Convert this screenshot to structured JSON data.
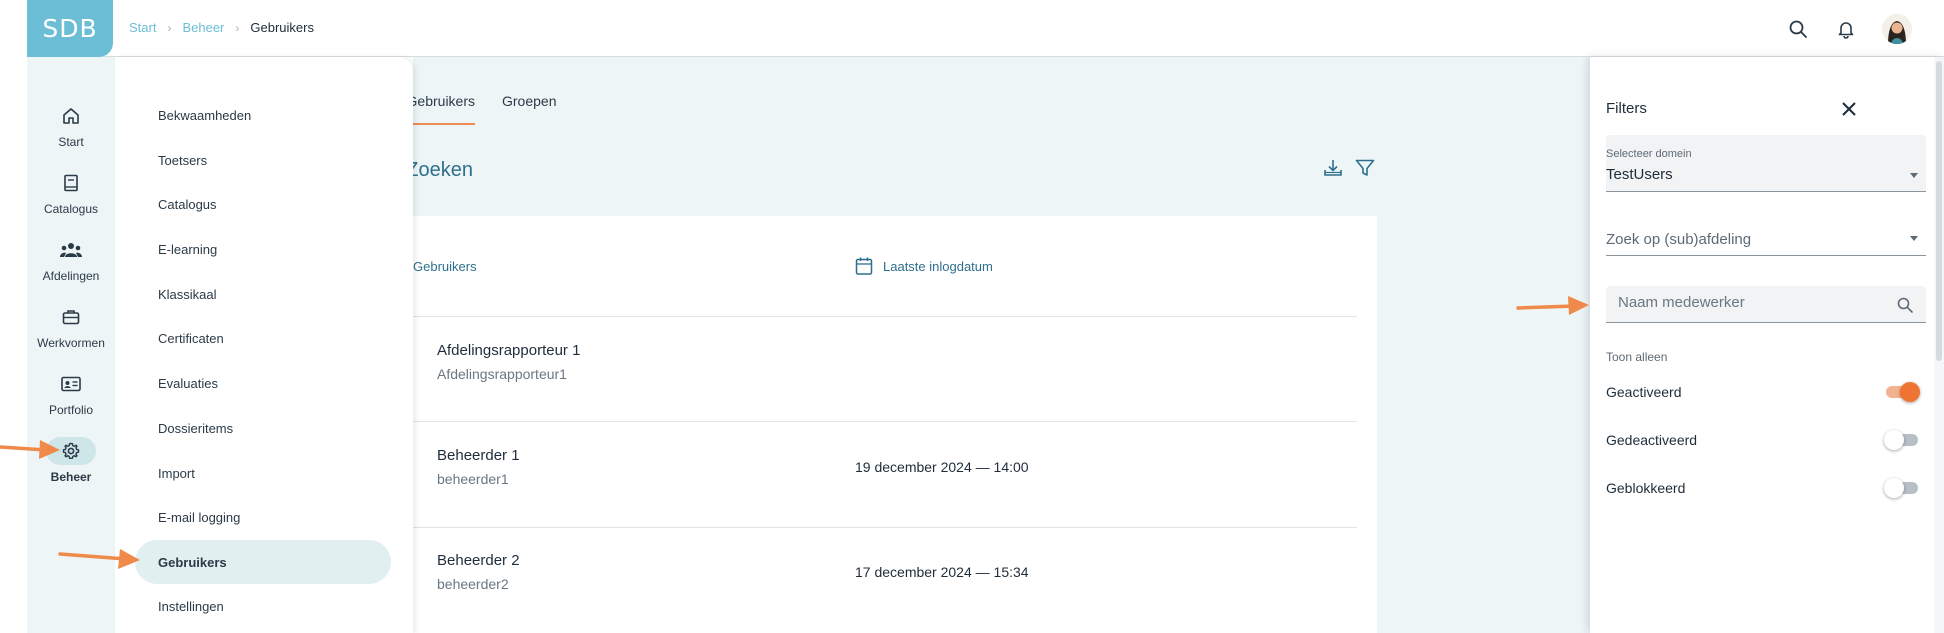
{
  "header": {
    "logo_text": "SDB",
    "breadcrumb": [
      {
        "label": "Start"
      },
      {
        "label": "Beheer"
      },
      {
        "label": "Gebruikers"
      }
    ],
    "icons": [
      "search-icon",
      "bell-icon",
      "avatar"
    ]
  },
  "rail": {
    "items": [
      {
        "label": "Start",
        "icon": "home-icon"
      },
      {
        "label": "Catalogus",
        "icon": "book-icon"
      },
      {
        "label": "Afdelingen",
        "icon": "group-icon"
      },
      {
        "label": "Werkvormen",
        "icon": "briefcase-icon"
      },
      {
        "label": "Portfolio",
        "icon": "id-card-icon"
      },
      {
        "label": "Beheer",
        "icon": "gear-icon",
        "active": true
      }
    ]
  },
  "submenu": {
    "items": [
      {
        "label": "Bekwaamheden"
      },
      {
        "label": "Toetsers"
      },
      {
        "label": "Catalogus"
      },
      {
        "label": "E-learning"
      },
      {
        "label": "Klassikaal"
      },
      {
        "label": "Certificaten"
      },
      {
        "label": "Evaluaties"
      },
      {
        "label": "Dossieritems"
      },
      {
        "label": "Import"
      },
      {
        "label": "E-mail logging"
      },
      {
        "label": "Gebruikers",
        "active": true
      },
      {
        "label": "Instellingen"
      }
    ]
  },
  "main": {
    "tabs": [
      {
        "label": "Gebruikers",
        "active": true
      },
      {
        "label": "Groepen"
      }
    ],
    "title": "Zoeken",
    "actions": [
      "download-icon",
      "filter-icon"
    ],
    "columns": {
      "users": "Gebruikers",
      "last_login": "Laatste inlogdatum"
    },
    "rows": [
      {
        "name": "Afdelingsrapporteur 1",
        "login": "Afdelingsrapporteur1",
        "last_login": ""
      },
      {
        "name": "Beheerder 1",
        "login": "beheerder1",
        "last_login": "19 december 2024 — 14:00"
      },
      {
        "name": "Beheerder 2",
        "login": "beheerder2",
        "last_login": "17 december 2024 — 15:34"
      }
    ]
  },
  "filters": {
    "title": "Filters",
    "domain_label": "Selecteer domein",
    "domain_value": "TestUsers",
    "department_placeholder": "Zoek op (sub)afdeling",
    "employee_placeholder": "Naam medewerker",
    "show_only_label": "Toon alleen",
    "toggles": [
      {
        "label": "Geactiveerd",
        "on": true
      },
      {
        "label": "Gedeactiveerd",
        "on": false
      },
      {
        "label": "Geblokkeerd",
        "on": false
      }
    ]
  },
  "colors": {
    "brand": "#6cbed6",
    "accent": "#ef7431",
    "sidebar_bg": "#eef5f7",
    "title_blue": "#2e6f8e",
    "annotation_arrow": "#f08a4b"
  }
}
